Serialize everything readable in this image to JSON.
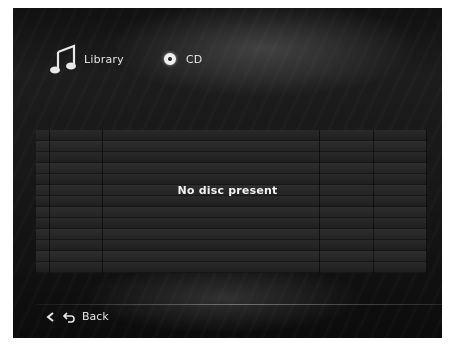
{
  "nav": {
    "library": {
      "label": "Library",
      "icon": "music-note-icon"
    },
    "cd": {
      "label": "CD",
      "icon": "cd-disc-icon"
    }
  },
  "table": {
    "empty_message": "No disc present"
  },
  "footer": {
    "back_label": "Back",
    "icons": [
      "left-arrow-icon",
      "back-arrow-icon"
    ]
  }
}
